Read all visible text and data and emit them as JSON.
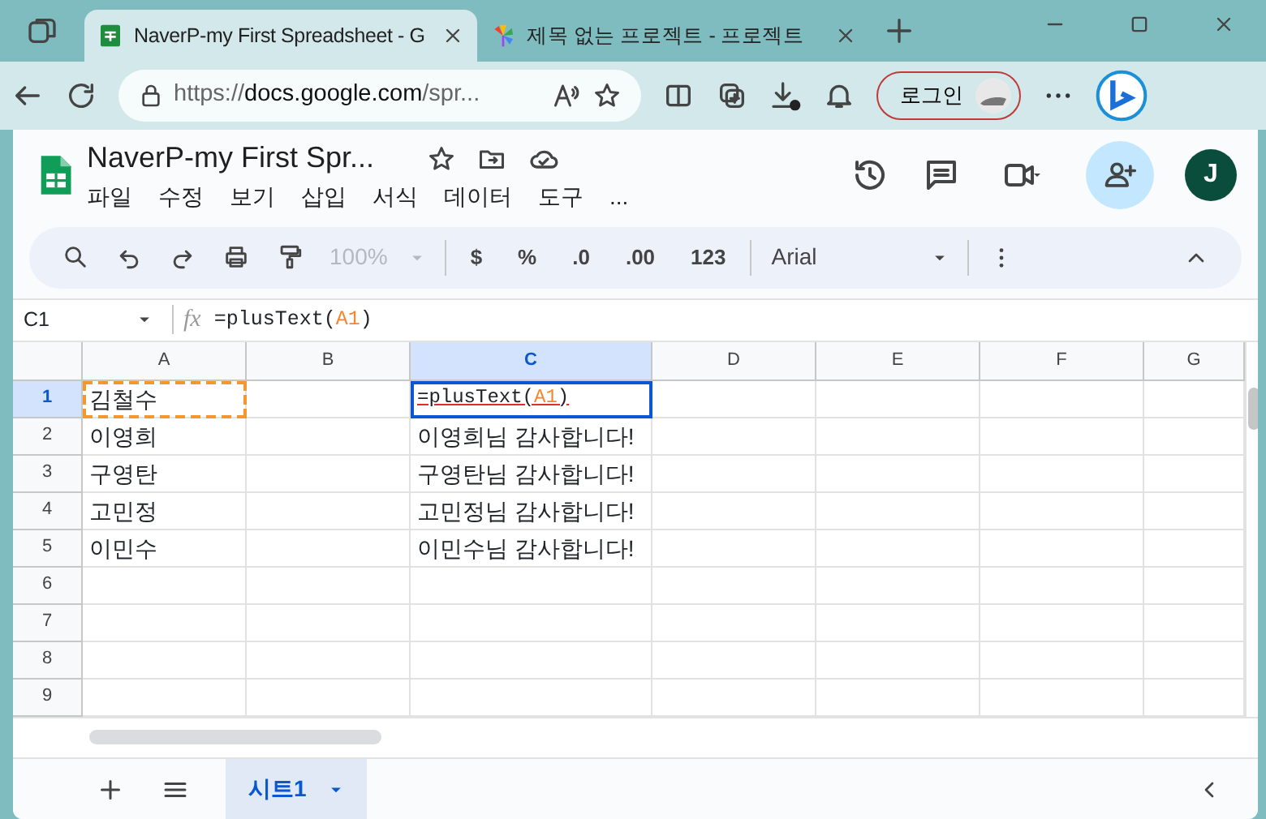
{
  "browser": {
    "tabs": [
      {
        "title": "NaverP-my First Spreadsheet - G",
        "selected": true
      },
      {
        "title": "제목 없는 프로젝트 - 프로젝트",
        "selected": false
      }
    ],
    "address": {
      "scheme": "https://",
      "host": "docs.google.com",
      "rest": "/spr..."
    },
    "login": "로그인"
  },
  "document": {
    "title": "NaverP-my First Spr...",
    "menus": [
      "파일",
      "수정",
      "보기",
      "삽입",
      "서식",
      "데이터",
      "도구",
      "..."
    ],
    "avatar": "J"
  },
  "toolbar": {
    "zoom": {
      "text": "100%",
      "disabled": true
    },
    "buttons": [
      "$",
      "%",
      ".0",
      ".00",
      "123"
    ],
    "font": "Arial"
  },
  "formula_bar": {
    "name_box": "C1",
    "fx": "fx",
    "parts": [
      {
        "text": "=plusText(",
        "kind": "plain"
      },
      {
        "text": "A1",
        "kind": "ref"
      },
      {
        "text": ")",
        "kind": "plain"
      }
    ]
  },
  "grid": {
    "columns": [
      {
        "label": "A",
        "selected": false
      },
      {
        "label": "B",
        "selected": false
      },
      {
        "label": "C",
        "selected": true
      },
      {
        "label": "D",
        "selected": false
      },
      {
        "label": "E",
        "selected": false
      },
      {
        "label": "F",
        "selected": false
      },
      {
        "label": "G",
        "selected": false
      }
    ],
    "rows": [
      {
        "label": "1",
        "selected": true,
        "cells": [
          {
            "text": "김철수",
            "kind": "copied"
          },
          null,
          {
            "kind": "editing",
            "parts": [
              {
                "text": "=plusText(",
                "kind": "plain"
              },
              {
                "text": "A1",
                "kind": "ref"
              },
              {
                "text": ")",
                "kind": "plain"
              }
            ]
          }
        ]
      },
      {
        "label": "2",
        "selected": false,
        "cells": [
          {
            "text": "이영희",
            "kind": "value"
          },
          null,
          {
            "text": "이영희님 감사합니다!",
            "kind": "value"
          }
        ]
      },
      {
        "label": "3",
        "selected": false,
        "cells": [
          {
            "text": "구영탄",
            "kind": "value"
          },
          null,
          {
            "text": "구영탄님 감사합니다!",
            "kind": "value"
          }
        ]
      },
      {
        "label": "4",
        "selected": false,
        "cells": [
          {
            "text": "고민정",
            "kind": "value"
          },
          null,
          {
            "text": "고민정님 감사합니다!",
            "kind": "value"
          }
        ]
      },
      {
        "label": "5",
        "selected": false,
        "cells": [
          {
            "text": "이민수",
            "kind": "value"
          },
          null,
          {
            "text": "이민수님 감사합니다!",
            "kind": "value"
          }
        ]
      },
      {
        "label": "6",
        "selected": false
      },
      {
        "label": "7",
        "selected": false
      },
      {
        "label": "8",
        "selected": false
      },
      {
        "label": "9",
        "selected": false
      }
    ]
  },
  "sheets": [
    {
      "name": "시트1",
      "selected": true
    }
  ]
}
